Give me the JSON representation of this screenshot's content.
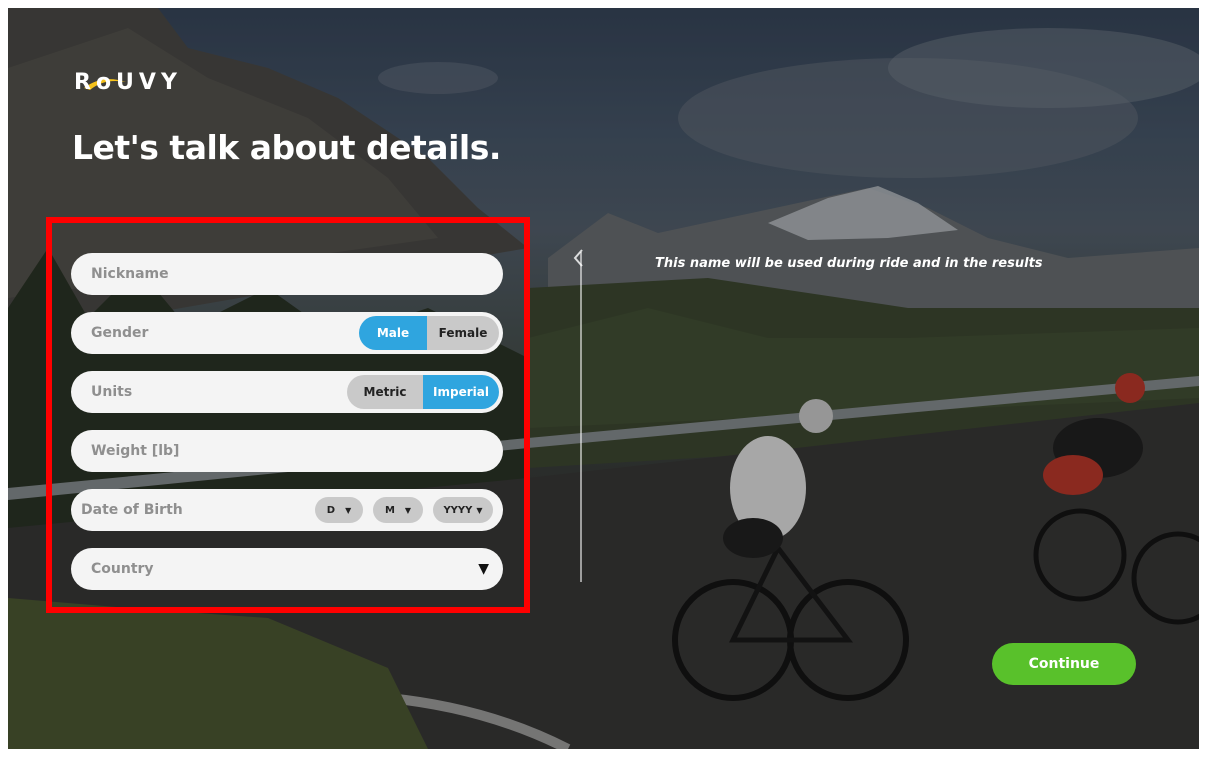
{
  "brand": {
    "logo_text": "RoUVY"
  },
  "page": {
    "title": "Let's talk about details."
  },
  "form": {
    "nickname": {
      "placeholder": "Nickname"
    },
    "gender": {
      "label": "Gender",
      "options": [
        "Male",
        "Female"
      ],
      "selected": "Male"
    },
    "units": {
      "label": "Units",
      "options": [
        "Metric",
        "Imperial"
      ],
      "selected": "Imperial"
    },
    "weight": {
      "placeholder": "Weight [lb]"
    },
    "dob": {
      "label": "Date of Birth",
      "day": "D",
      "month": "M",
      "year": "YYYY"
    },
    "country": {
      "placeholder": "Country"
    }
  },
  "hint": {
    "text": "This name will be used during ride and in the results"
  },
  "actions": {
    "continue_label": "Continue"
  },
  "colors": {
    "accent_blue": "#2fa5df",
    "continue_green": "#59c12b",
    "highlight_red": "#ff0000"
  },
  "icons": {
    "dropdown": "caret-down-icon",
    "collapse": "chevron-left-icon"
  }
}
